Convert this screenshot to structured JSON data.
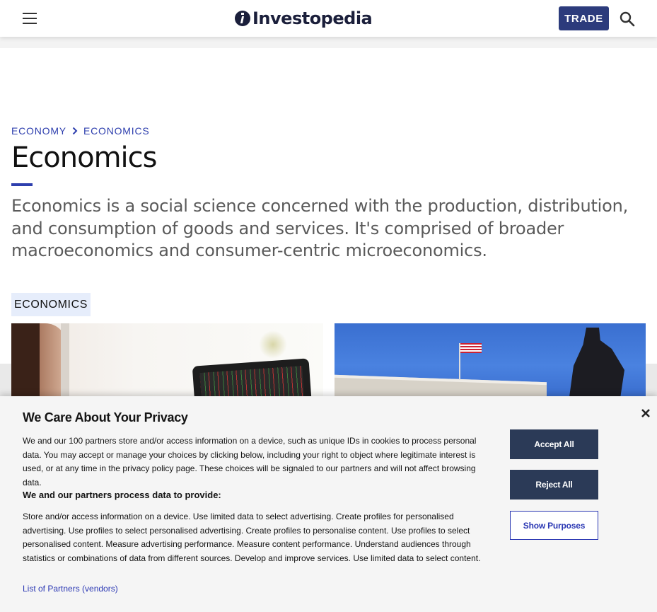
{
  "header": {
    "logo_text": "Investopedia",
    "trade_label": "TRADE"
  },
  "breadcrumb": {
    "items": [
      "ECONOMY",
      "ECONOMICS"
    ]
  },
  "page": {
    "title": "Economics",
    "intro": "Economics is a social science concerned with the production, distribution, and consumption of goods and services. It's comprised of broader macroeconomics and consumer-centric microeconomics.",
    "tag": "ECONOMICS"
  },
  "privacy": {
    "title": "We Care About Your Privacy",
    "text": "We and our 100 partners store and/or access information on a device, such as unique IDs in cookies to process personal data. You may accept or manage your choices by clicking below, including your right to object where legitimate interest is used, or at any time in the privacy policy page. These choices will be signaled to our partners and will not affect browsing data.",
    "subheading": "We and our partners process data to provide:",
    "purposes": "Store and/or access information on a device. Use limited data to select advertising. Create profiles for personalised advertising. Use profiles to select personalised advertising. Create profiles to personalise content. Use profiles to select personalised content. Measure advertising performance. Measure content performance. Understand audiences through statistics or combinations of data from different sources. Develop and improve services. Use limited data to select content.",
    "partners_link": "List of Partners (vendors)",
    "accept_label": "Accept All",
    "reject_label": "Reject All",
    "purposes_label": "Show Purposes"
  },
  "colors": {
    "accent_blue": "#2e3fae",
    "trade_bg": "#2c3b7c",
    "button_dark": "#2b3a57",
    "tag_bg": "#e6edfb"
  }
}
